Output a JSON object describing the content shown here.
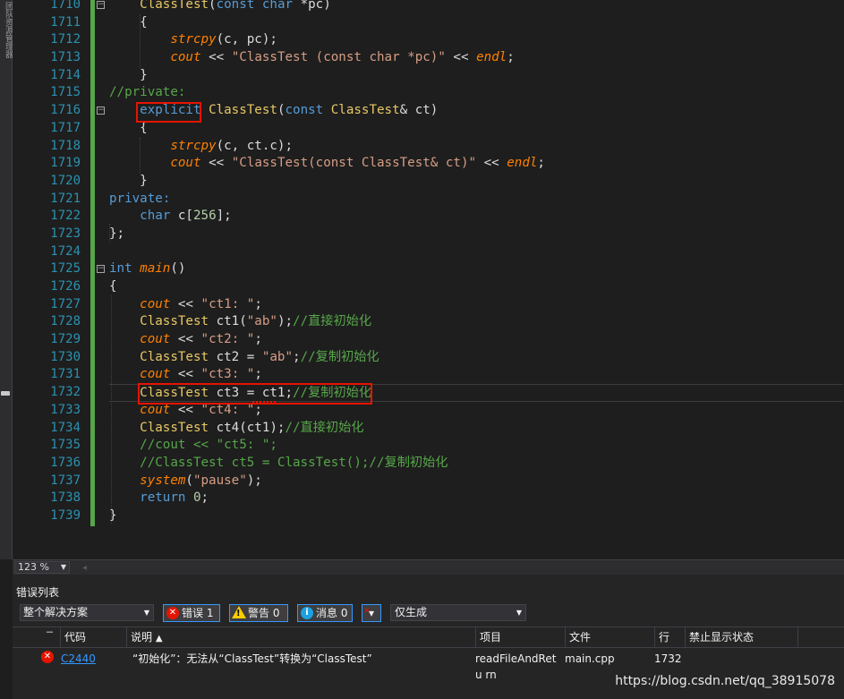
{
  "side_strip": {
    "label": "团队资源管理器"
  },
  "editor": {
    "line_numbers": [
      "1710",
      "1711",
      "1712",
      "1713",
      "1714",
      "1715",
      "1716",
      "1717",
      "1718",
      "1719",
      "1720",
      "1721",
      "1722",
      "1723",
      "1724",
      "1725",
      "1726",
      "1727",
      "1728",
      "1729",
      "1730",
      "1731",
      "1732",
      "1733",
      "1734",
      "1735",
      "1736",
      "1737",
      "1738",
      "1739"
    ],
    "tokens": {
      "ClassTest": "ClassTest",
      "const": "const",
      "char": "char",
      "explicit": "explicit",
      "private": "private:",
      "private_comment": "//private:",
      "int": "int",
      "main": "main",
      "cout": "cout",
      "strcpy": "strcpy",
      "endl": "endl",
      "system": "system",
      "return": "return"
    },
    "strings": {
      "s1713": "\"ClassTest (const char *pc)\"",
      "s1719": "\"ClassTest(const ClassTest& ct)\"",
      "s1727": "\"ct1: \"",
      "s1728": "\"ab\"",
      "s1729": "\"ct2: \"",
      "s1730": "\"ab\"",
      "s1731": "\"ct3: \"",
      "s1733": "\"ct4: \"",
      "s1737": "\"pause\""
    },
    "comments": {
      "c1728": "//直接初始化",
      "c1730": "//复制初始化",
      "c1732": "//复制初始化",
      "c1734": "//直接初始化",
      "c1735": "//cout << \"ct5: \";",
      "c1736": "//ClassTest ct5 = ClassTest();//复制初始化"
    },
    "numbers": {
      "n256": "256",
      "n0": "0"
    }
  },
  "zoom": {
    "value": "123 %"
  },
  "error_list": {
    "title": "错误列表",
    "scope": "整个解决方案",
    "errors_label": "错误 1",
    "warnings_label": "警告 0",
    "messages_label": "消息 0",
    "build_filter": "仅生成",
    "columns": [
      "代码",
      "说明",
      "项目",
      "文件",
      "行",
      "禁止显示状态"
    ],
    "sort_indicator": "▲",
    "rows": [
      {
        "code": "C2440",
        "description": "“初始化”：无法从“ClassTest”转换为“ClassTest”",
        "project": "readFileAndRetu rn",
        "file": "main.cpp",
        "line": "1732",
        "suppression": ""
      }
    ]
  },
  "watermark": "https://blog.csdn.net/qq_38915078",
  "colors": {
    "keyword": "#569cd6",
    "type": "#e8c864",
    "function": "#ff8000",
    "string": "#d69d85",
    "comment": "#57a64a",
    "error": "#e51400"
  }
}
